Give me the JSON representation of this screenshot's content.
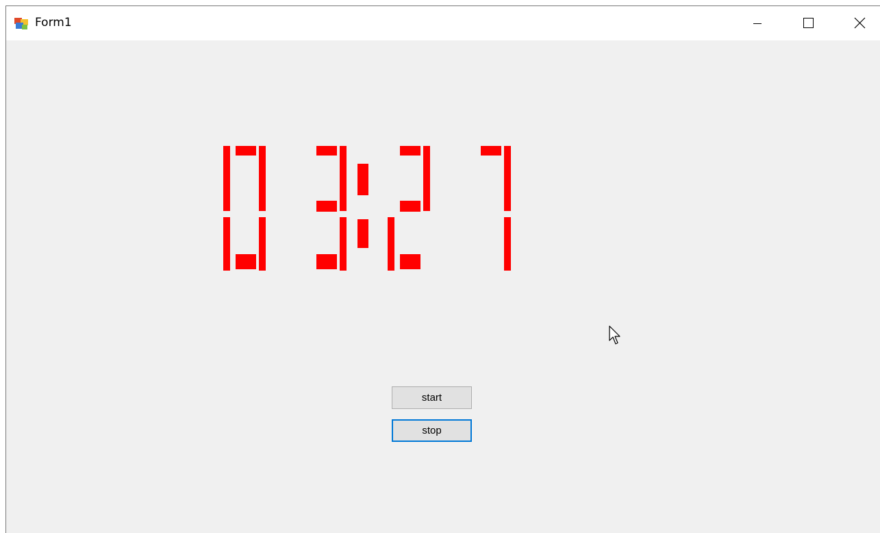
{
  "window": {
    "title": "Form1"
  },
  "icons": {
    "app": "app-window-icon",
    "minimize": "minimize-icon",
    "maximize": "maximize-icon",
    "close": "close-icon",
    "cursor": "mouse-pointer-icon"
  },
  "clock": {
    "text": "03:27",
    "digits": [
      "0",
      "3",
      "2",
      "7"
    ],
    "color": "#ff0000"
  },
  "buttons": {
    "start_label": "start",
    "stop_label": "stop"
  },
  "colors": {
    "window_bg": "#f0f0f0",
    "titlebar_bg": "#ffffff",
    "focus_border": "#0078d7",
    "segment": "#ff0000"
  }
}
